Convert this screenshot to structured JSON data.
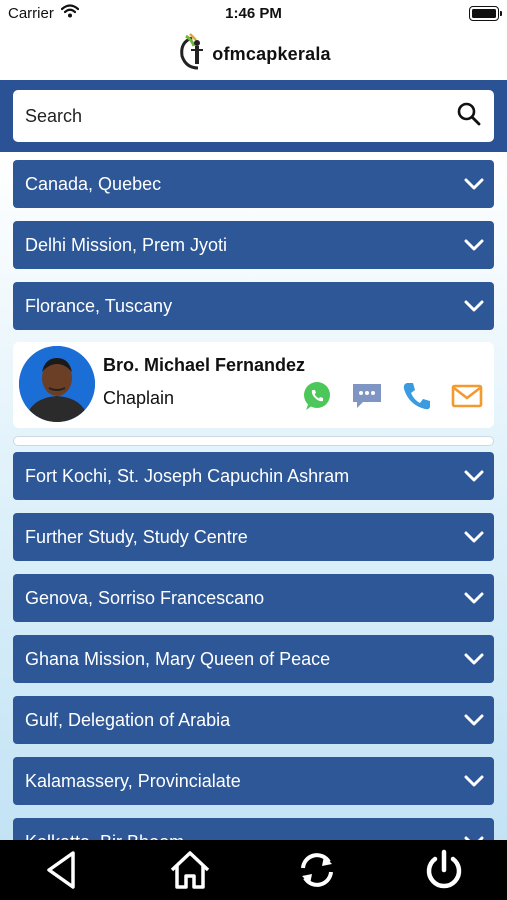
{
  "status_bar": {
    "carrier": "Carrier",
    "time": "1:46 PM"
  },
  "header": {
    "logo_text": "ofmcapkerala"
  },
  "search": {
    "placeholder": "Search",
    "value": ""
  },
  "list": {
    "items_above": [
      {
        "label": "Canada, Quebec"
      },
      {
        "label": "Delhi Mission, Prem Jyoti"
      },
      {
        "label": "Florance, Tuscany"
      }
    ],
    "expanded_member": {
      "name": "Bro. Michael Fernandez",
      "role": "Chaplain"
    },
    "items_below": [
      {
        "label": "Fort Kochi, St. Joseph Capuchin Ashram"
      },
      {
        "label": "Further Study, Study Centre"
      },
      {
        "label": "Genova, Sorriso Francescano"
      },
      {
        "label": "Ghana Mission, Mary Queen of Peace"
      },
      {
        "label": "Gulf, Delegation of Arabia"
      },
      {
        "label": "Kalamassery, Provincialate"
      },
      {
        "label": "Kolkatta, Bir Bhoom"
      }
    ]
  },
  "colors": {
    "header_band": "#2a5294",
    "row_bg": "#2d5797",
    "whatsapp": "#4cc85b",
    "message": "#7f95c4",
    "phone": "#3a9be0",
    "mail": "#f29a2e"
  },
  "tab_bar": {
    "icons": [
      "back-icon",
      "home-icon",
      "refresh-icon",
      "power-icon"
    ]
  }
}
